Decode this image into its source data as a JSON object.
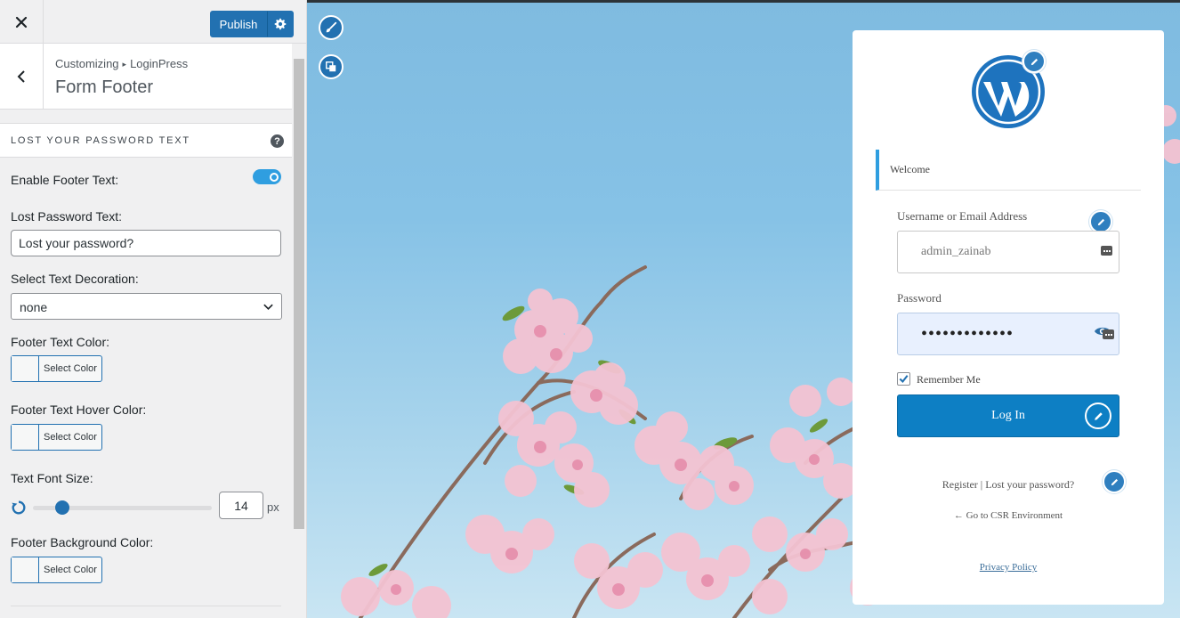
{
  "sidebar": {
    "publish_label": "Publish",
    "breadcrumb_root": "Customizing",
    "breadcrumb_separator": "▸",
    "breadcrumb_current": "LoginPress",
    "section_title": "Form Footer",
    "control_header": "LOST YOUR PASSWORD TEXT",
    "help_symbol": "?",
    "enable_footer_label": "Enable Footer Text:",
    "enable_footer_on": true,
    "lost_password_label": "Lost Password Text:",
    "lost_password_value": "Lost your password?",
    "decoration_label": "Select Text Decoration:",
    "decoration_value": "none",
    "footer_color_label": "Footer Text Color:",
    "footer_hover_color_label": "Footer Text Hover Color:",
    "font_size_label": "Text Font Size:",
    "font_size_value": "14",
    "font_size_unit": "px",
    "footer_bg_color_label": "Footer Background Color:",
    "select_color_label": "Select Color"
  },
  "preview": {
    "welcome_text": "Welcome",
    "username_label": "Username or Email Address",
    "username_value": "admin_zainab",
    "password_label": "Password",
    "password_value": "•••••••••••••",
    "remember_label": "Remember Me",
    "remember_checked": true,
    "login_button": "Log In",
    "register_link": "Register",
    "footer_separator": "|",
    "lost_password_link": "Lost your password?",
    "back_link": "← Go to CSR Environment",
    "privacy_link": "Privacy Policy"
  },
  "colors": {
    "admin_blue": "#2271b1",
    "toggle_on": "#2f9ee0",
    "login_button": "#0d7fc4",
    "welcome_accent": "#2f9ee0"
  },
  "icons": [
    "close-icon",
    "gear-icon",
    "back-chevron-icon",
    "help-icon",
    "chevron-down-icon",
    "reset-icon",
    "paint-brush-icon",
    "layers-icon",
    "wordpress-logo-icon",
    "pencil-icon",
    "keyboard-icon",
    "eye-icon",
    "checkmark-icon"
  ]
}
